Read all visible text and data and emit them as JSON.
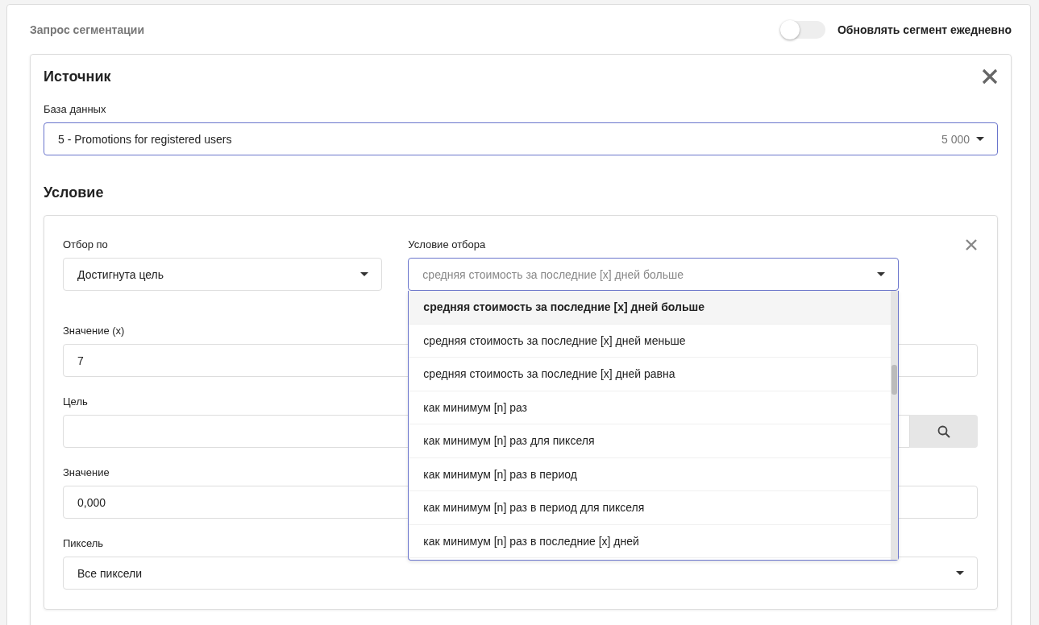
{
  "header": {
    "title": "Запрос сегментации",
    "toggle": {
      "label": "Обновлять сегмент ежедневно",
      "on": false
    }
  },
  "source": {
    "title": "Источник",
    "database": {
      "label": "База данных",
      "value": "5 - Promotions for registered users",
      "count": "5 000"
    }
  },
  "condition": {
    "title": "Условие",
    "filter_by": {
      "label": "Отбор по",
      "value": "Достигнута цель"
    },
    "filter_condition": {
      "label": "Условие отбора",
      "value": "средняя стоимость за последние [x] дней больше",
      "expanded": true,
      "options": [
        {
          "label": "средняя стоимость за последние [x] дней больше",
          "selected": true
        },
        {
          "label": "средняя стоимость за последние [x] дней меньше",
          "selected": false
        },
        {
          "label": "средняя стоимость за последние [x] дней равна",
          "selected": false
        },
        {
          "label": "как минимум [n] раз",
          "selected": false
        },
        {
          "label": "как минимум [n] раз для пикселя",
          "selected": false
        },
        {
          "label": "как минимум [n] раз в период",
          "selected": false
        },
        {
          "label": "как минимум [n] раз в период для пикселя",
          "selected": false
        },
        {
          "label": "как минимум [n] раз в последние [x] дней",
          "selected": false
        }
      ]
    },
    "fields": [
      {
        "kind": "input",
        "label": "Значение (x)",
        "value": "7"
      },
      {
        "kind": "search",
        "label": "Цель"
      },
      {
        "kind": "input",
        "label": "Значение",
        "value": "0,000"
      },
      {
        "kind": "select",
        "label": "Пиксель",
        "value": "Все пиксели"
      }
    ]
  }
}
